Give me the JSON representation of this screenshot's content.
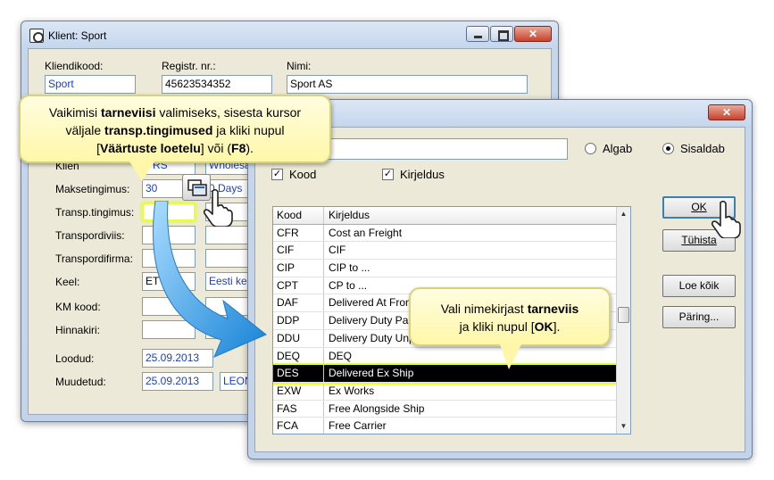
{
  "client_window": {
    "title": "Klient: Sport",
    "fields": {
      "code_label": "Kliendikood:",
      "code_value": "Sport",
      "reg_label": "Registr. nr.:",
      "reg_value": "45623534352",
      "name_label": "Nimi:",
      "name_value": "Sport AS",
      "class_label": "Klien",
      "class_value": "VRS",
      "class_desc": "Wholesa",
      "payment_label": "Maksetingimus:",
      "payment_value": "30",
      "payment_desc": "0 Days",
      "delivery_terms_label": "Transp.tingimus:",
      "delivery_terms_value": "",
      "transport_method_label": "Transpordiviis:",
      "transport_company_label": "Transpordifirma:",
      "language_label": "Keel:",
      "language_value": "ET",
      "language_desc": "Eesti kee",
      "vat_label": "KM kood:",
      "price_list_label": "Hinnakiri:",
      "created_label": "Loodud:",
      "created_value": "25.09.2013",
      "modified_label": "Muudetud:",
      "modified_value": "25.09.2013",
      "modified_user": "LEON"
    }
  },
  "list_window": {
    "search_value": "",
    "radio_starts": "Algab",
    "radio_contains": "Sisaldab",
    "check_code": "Kood",
    "check_desc": "Kirjeldus",
    "ok_label": "OK",
    "cancel_label": "Tühista",
    "load_all_label": "Loe kõik",
    "query_label": "Päring...",
    "columns": [
      "Kood",
      "Kirjeldus"
    ],
    "rows": [
      {
        "code": "CFR",
        "desc": "Cost an Freight"
      },
      {
        "code": "CIF",
        "desc": "CIF"
      },
      {
        "code": "CIP",
        "desc": "CIP to ..."
      },
      {
        "code": "CPT",
        "desc": "CP to ..."
      },
      {
        "code": "DAF",
        "desc": "Delivered At Fron"
      },
      {
        "code": "DDP",
        "desc": "Delivery Duty Pai"
      },
      {
        "code": "DDU",
        "desc": "Delivery Duty Unp"
      },
      {
        "code": "DEQ",
        "desc": "DEQ"
      },
      {
        "code": "DES",
        "desc": "Delivered Ex Ship"
      },
      {
        "code": "EXW",
        "desc": "Ex Works"
      },
      {
        "code": "FAS",
        "desc": "Free Alongside Ship"
      },
      {
        "code": "FCA",
        "desc": "Free Carrier"
      }
    ]
  },
  "callout_1": {
    "t1": "Vaikimisi ",
    "b1": "tarneviisi",
    "t2": " valimiseks, sisesta kursor",
    "t3": "väljale ",
    "b2": "transp.tingimused",
    "t4": "  ja kliki nupul",
    "t5": "[",
    "b3": "Väärtuste loetelu",
    "t6": "] või (",
    "b4": "F8",
    "t7": ")."
  },
  "callout_2": {
    "t1": "Vali nimekirjast ",
    "b1": "tarneviis",
    "t2": "ja kliki nupul [",
    "b2": "OK",
    "t3": "]."
  },
  "colors": {
    "highlight": "#e7ff3a",
    "arrow": "#2a9be0",
    "callout_bg": "#fff7a8"
  }
}
